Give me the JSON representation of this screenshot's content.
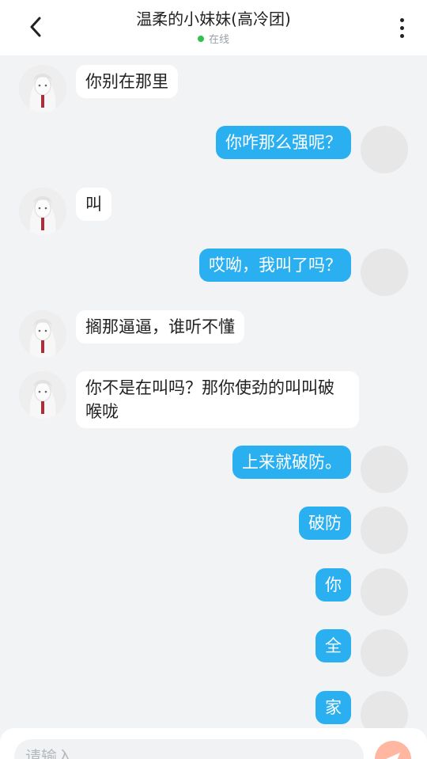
{
  "header": {
    "title": "温柔的小妹妹(高冷团)",
    "status": "在线"
  },
  "colors": {
    "accent": "#2aaff0",
    "online": "#2fc24f",
    "background": "#f2f3f5",
    "send_button": "#ffb7a2"
  },
  "icons": {
    "back": "chevron-left-icon",
    "more": "more-vertical-icon",
    "send": "send-icon"
  },
  "messages": [
    {
      "side": "left",
      "text": "你别在那里"
    },
    {
      "side": "right",
      "text": "你咋那么强呢？"
    },
    {
      "side": "left",
      "text": "叫"
    },
    {
      "side": "right",
      "text": "哎呦，我叫了吗？"
    },
    {
      "side": "left",
      "text": "搁那逼逼，谁听不懂"
    },
    {
      "side": "left",
      "text": "你不是在叫吗？那你使劲的叫叫破喉咙"
    },
    {
      "side": "right",
      "text": "上来就破防。"
    },
    {
      "side": "right",
      "text": "破防"
    },
    {
      "side": "right",
      "text": "你"
    },
    {
      "side": "right",
      "text": "全"
    },
    {
      "side": "right",
      "text": "家"
    }
  ],
  "input": {
    "placeholder": "请输入"
  }
}
